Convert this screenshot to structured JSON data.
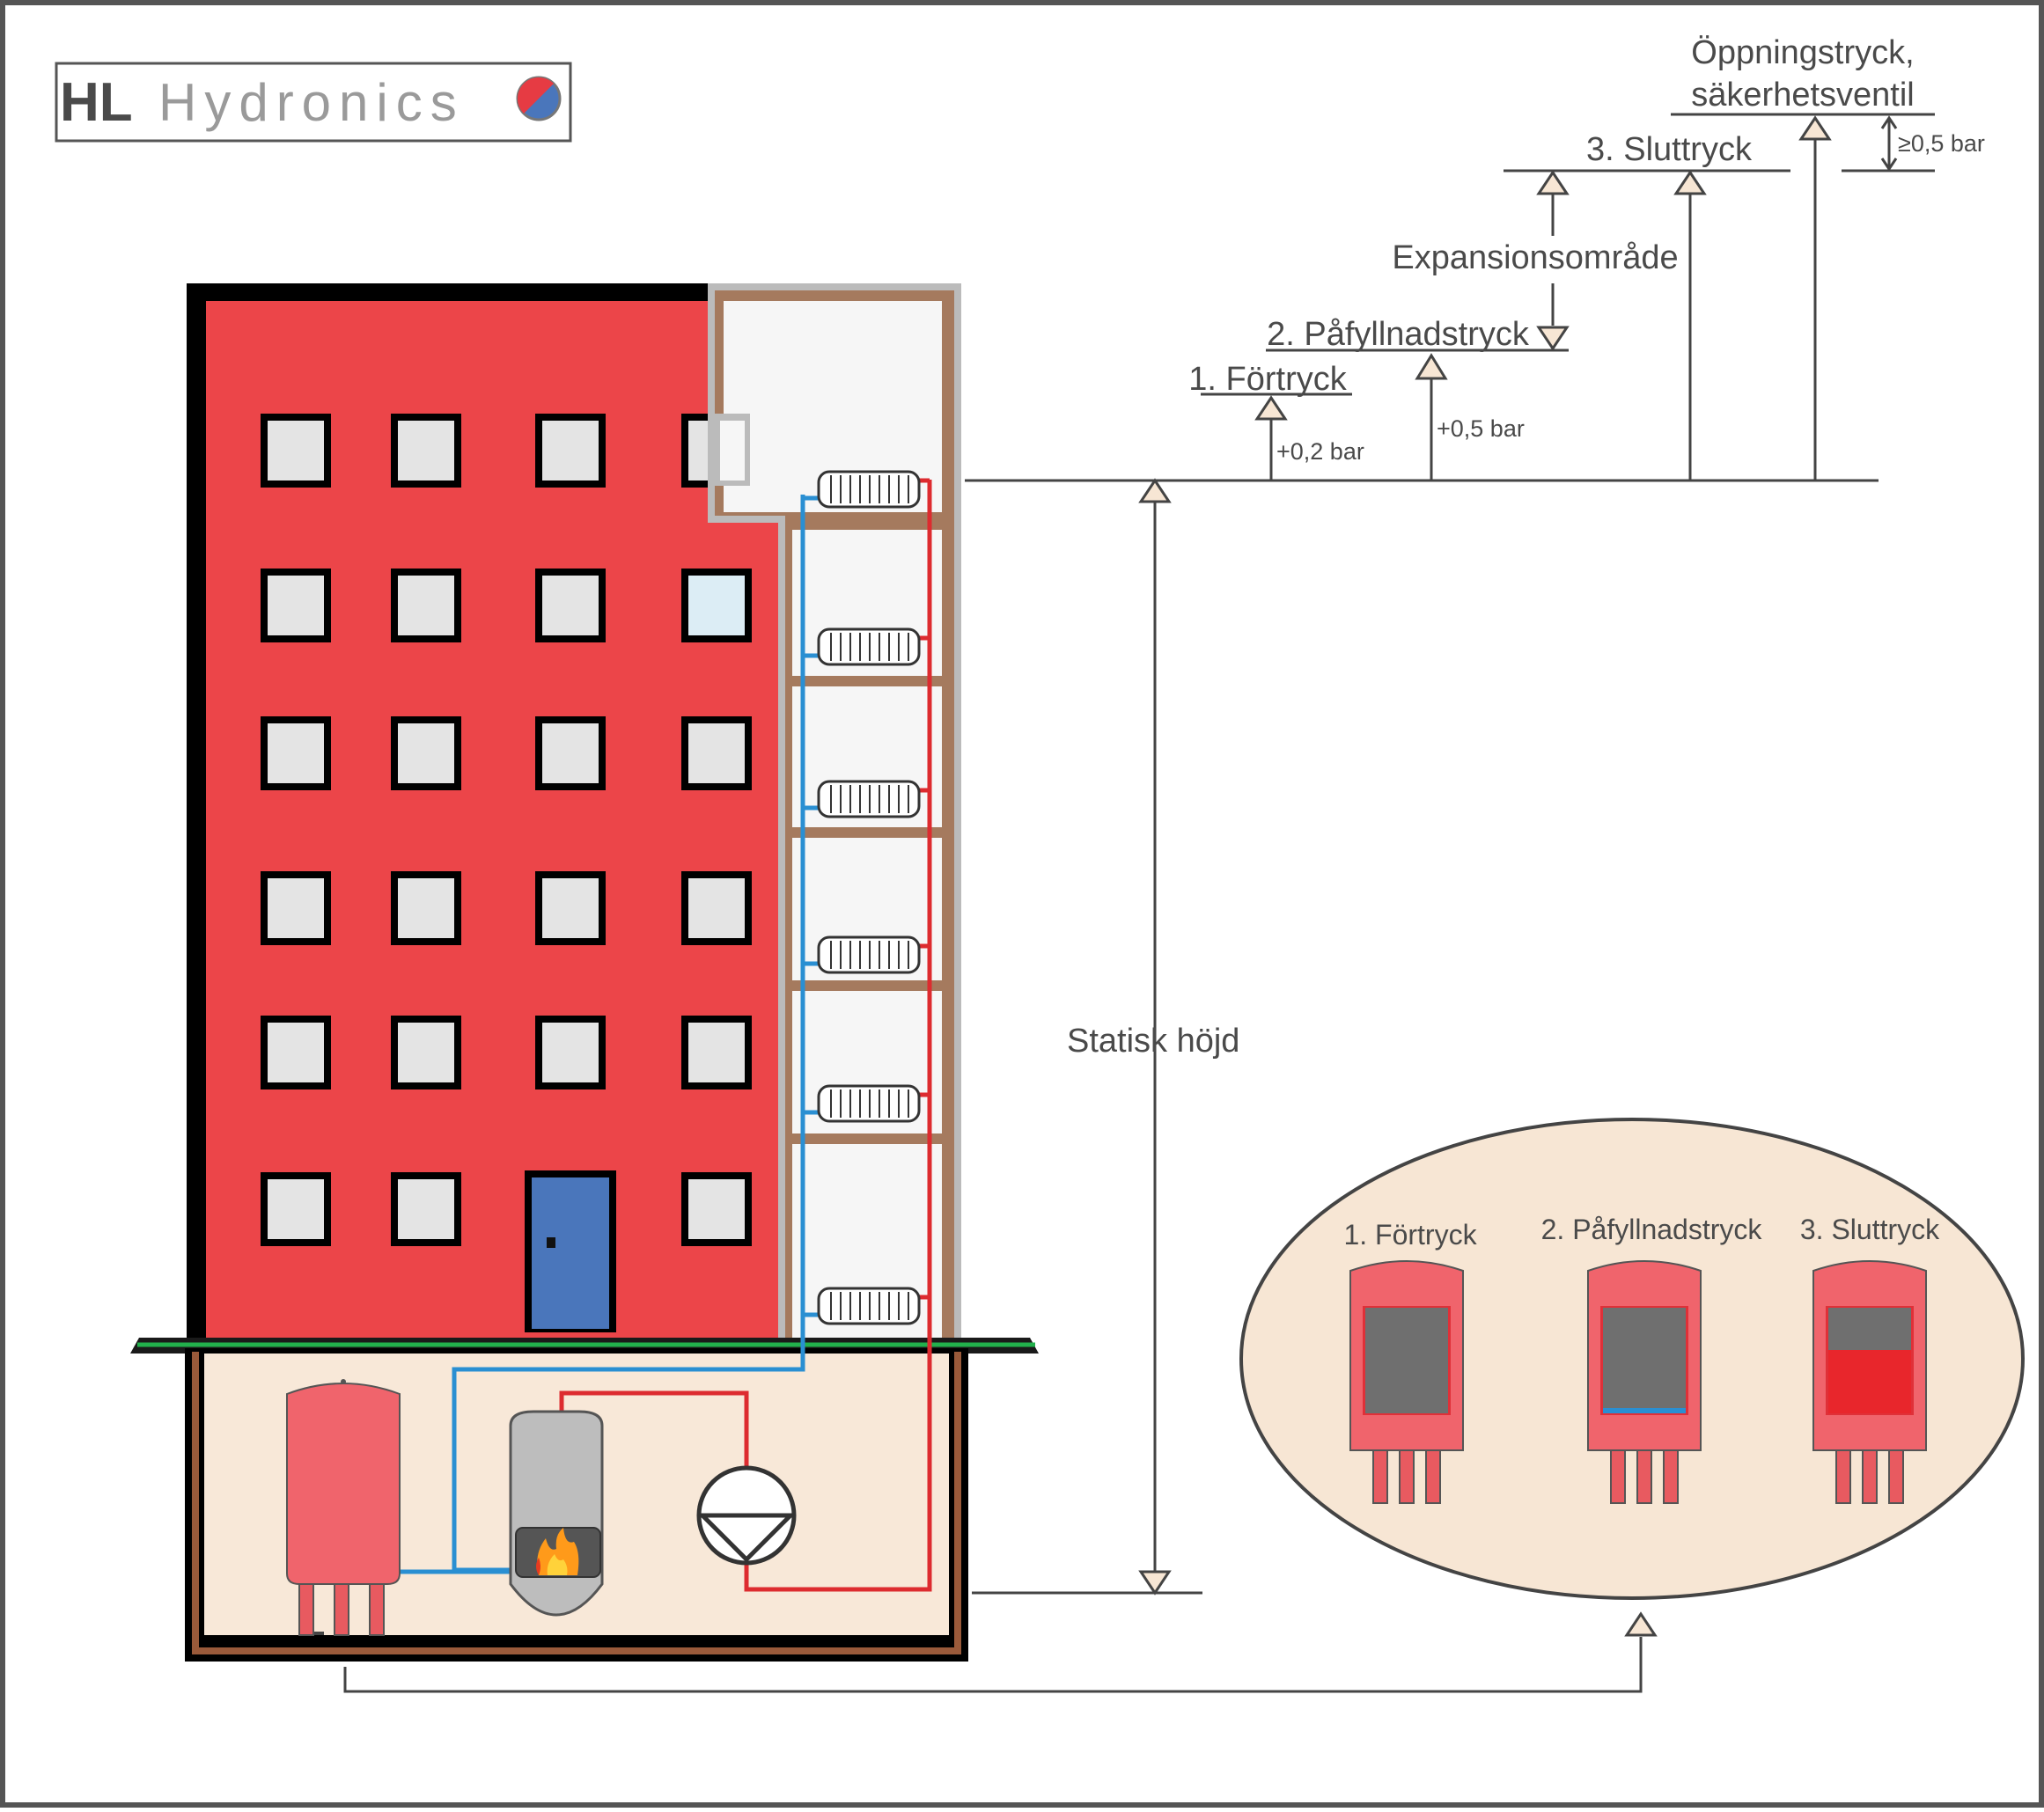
{
  "logo": {
    "brand": "HL",
    "name": "Hydronics"
  },
  "pressure_levels": {
    "opening_pressure_line1": "Öppningstryck,",
    "opening_pressure_line2": "säkerhetsventil",
    "final_pressure": "3. Sluttryck",
    "expansion_range": "Expansionsområde",
    "fill_pressure": "2. Påfyllnadstryck",
    "pre_pressure": "1. Förtryck",
    "delta_pre": "+0,2 bar",
    "delta_fill": "+0,5 bar",
    "delta_safety": "≥0,5 bar"
  },
  "static_height_label": "Statisk höjd",
  "vessel_states": {
    "pre_pressure": "1. Förtryck",
    "fill_pressure": "2. Påfyllnadstryck",
    "final_pressure": "3. Sluttryck",
    "water_level_fill": 0.05,
    "water_level_final": 0.6
  },
  "colors": {
    "facade": "#ec4549",
    "supply_pipe": "#dd2b2f",
    "return_pipe": "#2a8fd2",
    "vessel": "#f0646c",
    "door": "#4a76bb",
    "basement": "#f8e8d8",
    "ellipse": "#f7e6d4",
    "earth": "#9a5a3a"
  }
}
